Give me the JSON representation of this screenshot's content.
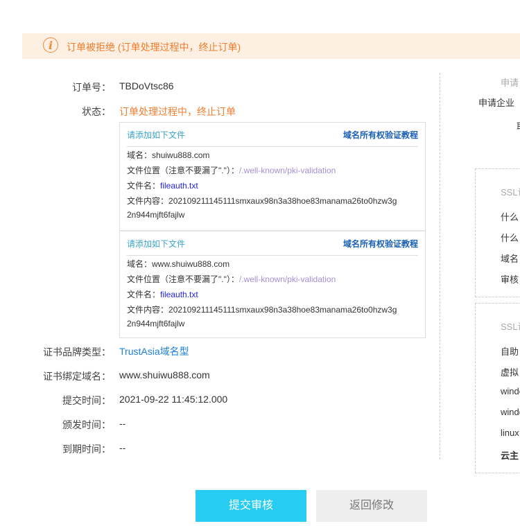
{
  "banner": {
    "icon": "info-icon",
    "text": "订单被拒绝 (订单处理过程中，终止订单)"
  },
  "fields": {
    "order_no": {
      "label": "订单号：",
      "value": "TBDoVtsc86"
    },
    "status": {
      "label": "状态：",
      "value": "订单处理过程中，终止订单"
    },
    "brand": {
      "label": "证书品牌类型：",
      "value": "TrustAsia域名型"
    },
    "domain": {
      "label": "证书绑定域名：",
      "value": "www.shuiwu888.com"
    },
    "submit_time": {
      "label": "提交时间：",
      "value": "2021-09-22 11:45:12.000"
    },
    "issue_time": {
      "label": "颁发时间：",
      "value": "--"
    },
    "expire_time": {
      "label": "到期时间：",
      "value": "--"
    }
  },
  "validation": [
    {
      "title": "请添加如下文件",
      "tutorial": "域名所有权验证教程",
      "domain_label": "域名：",
      "domain": "shuiwu888.com",
      "path_label": "文件位置（注意不要漏了\".\"）：",
      "path": "/.well-known/pki-validation",
      "fname_label": "文件名：",
      "fname": "fileauth.txt",
      "content_label": "文件内容：",
      "content1": "202109211145111smxaux98n3a38hoe83manama26to0hzw3g",
      "content2": "2n944mjft6fajlw"
    },
    {
      "title": "请添加如下文件",
      "tutorial": "域名所有权验证教程",
      "domain_label": "域名：",
      "domain": "www.shuiwu888.com",
      "path_label": "文件位置（注意不要漏了\".\"）：",
      "path": "/.well-known/pki-validation",
      "fname_label": "文件名：",
      "fname": "fileauth.txt",
      "content_label": "文件内容：",
      "content1": "202109211145111smxaux98n3a38hoe83manama26to0hzw3g",
      "content2": "2n944mjft6fajlw"
    }
  ],
  "right": {
    "header": "申请",
    "company": "申请企业",
    "partial": "耶",
    "panel1": {
      "title": "SSL证",
      "items": [
        "什么",
        "什么",
        "域名",
        "审核"
      ]
    },
    "panel2": {
      "title": "SSL证",
      "items": [
        "自助",
        "虚拟",
        "windo",
        "windo",
        "linux",
        "云主"
      ]
    }
  },
  "buttons": {
    "submit": "提交审核",
    "back": "返回修改"
  }
}
